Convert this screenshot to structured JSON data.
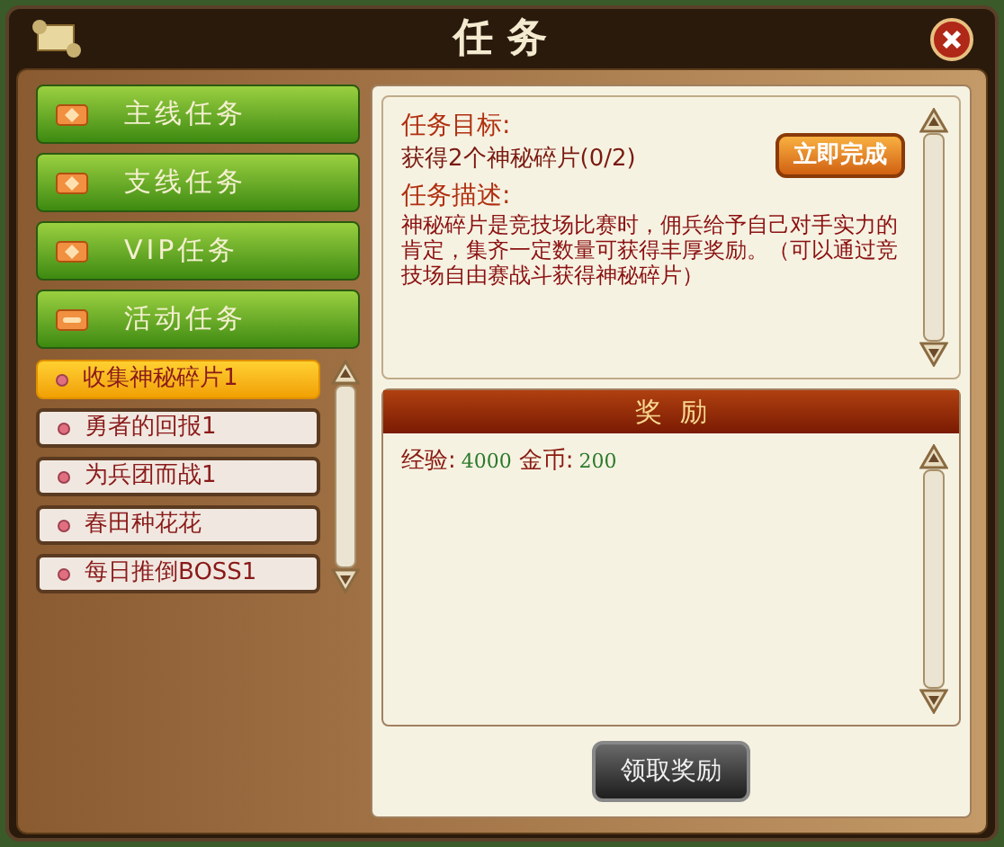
{
  "window": {
    "title": "任务"
  },
  "categories": [
    {
      "label": "主线任务",
      "expanded": false
    },
    {
      "label": "支线任务",
      "expanded": false
    },
    {
      "label": "VIP任务",
      "expanded": false
    },
    {
      "label": "活动任务",
      "expanded": true
    }
  ],
  "quests": [
    {
      "label": "收集神秘碎片1",
      "selected": true
    },
    {
      "label": "勇者的回报1",
      "selected": false
    },
    {
      "label": "为兵团而战1",
      "selected": false
    },
    {
      "label": "春田种花花",
      "selected": false
    },
    {
      "label": "每日推倒BOSS1",
      "selected": false
    }
  ],
  "detail": {
    "goal_heading": "任务目标:",
    "goal": "获得2个神秘碎片(0/2)",
    "complete_button": "立即完成",
    "description_heading": "任务描述:",
    "description": "神秘碎片是竞技场比赛时，佣兵给予自己对手实力的肯定，集齐一定数量可获得丰厚奖励。（可以通过竞技场自由赛战斗获得神秘碎片）"
  },
  "rewards": {
    "title": "奖  励",
    "items": [
      {
        "label": "经验:",
        "value": "4000"
      },
      {
        "label": "金币:",
        "value": "200"
      }
    ]
  },
  "claim_button": "领取奖励"
}
